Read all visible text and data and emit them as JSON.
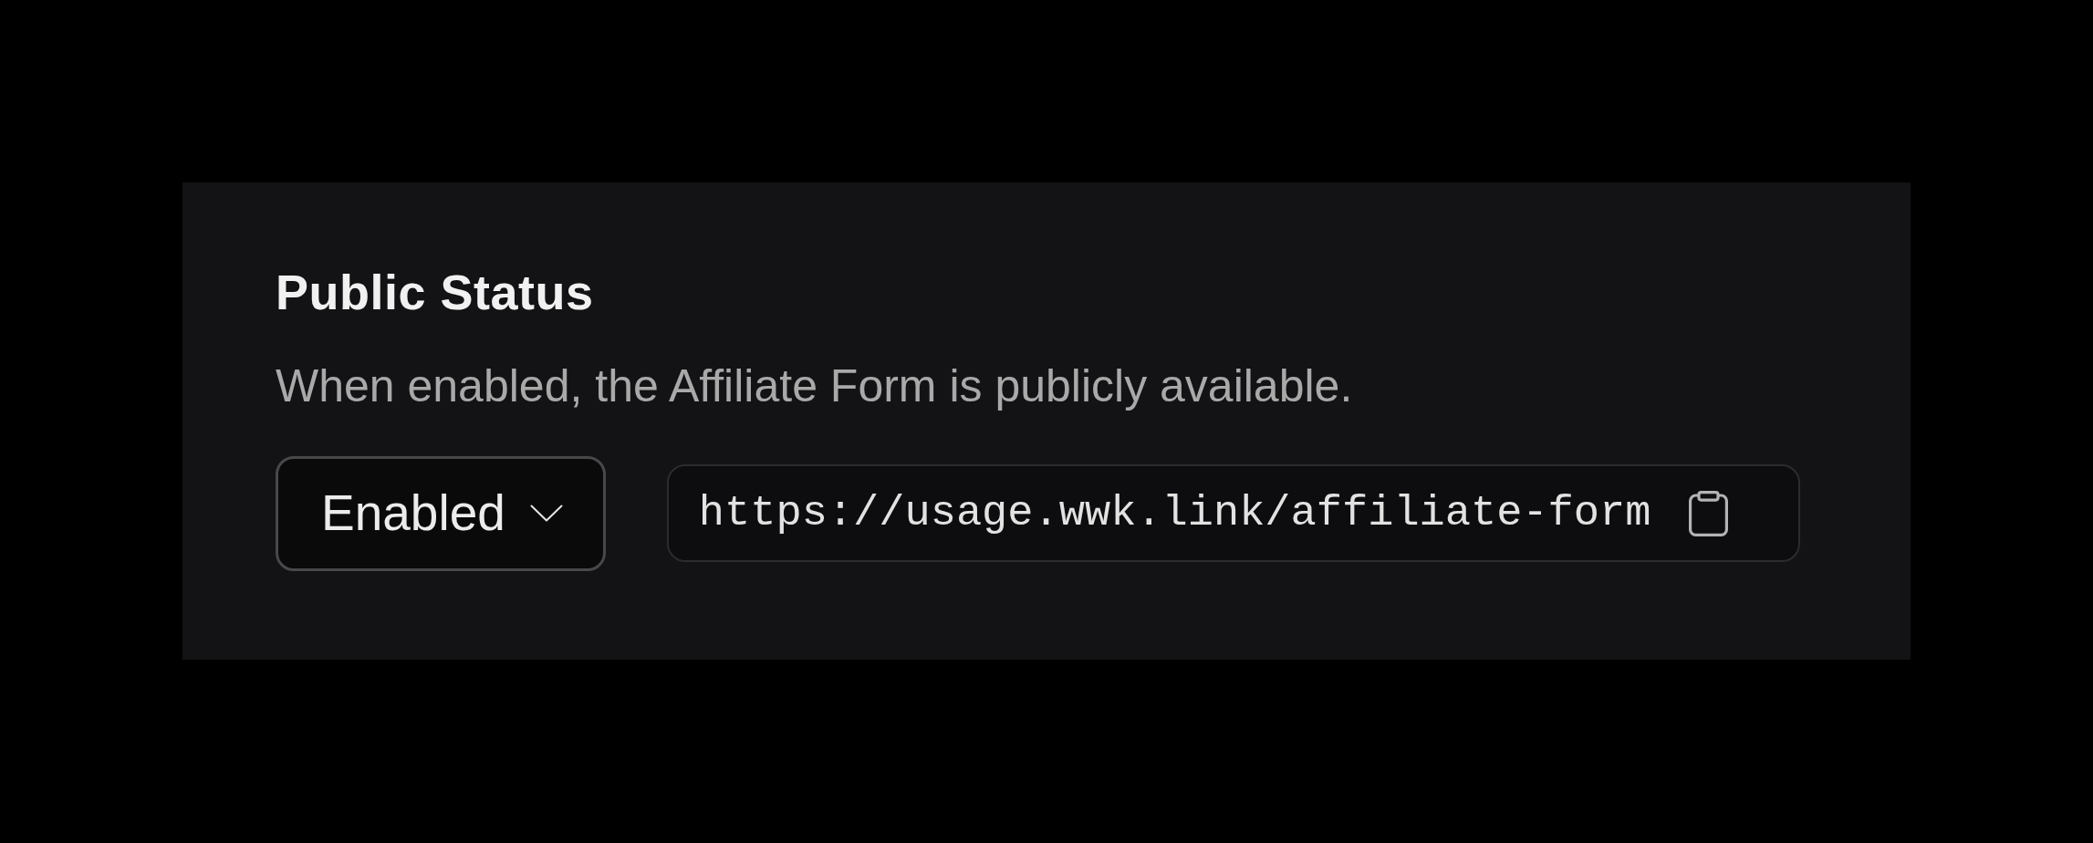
{
  "section": {
    "title": "Public Status",
    "description": "When enabled, the Affiliate Form is publicly available."
  },
  "status_select": {
    "value": "Enabled"
  },
  "public_link": {
    "url": "https://usage.wwk.link/affiliate-form"
  }
}
